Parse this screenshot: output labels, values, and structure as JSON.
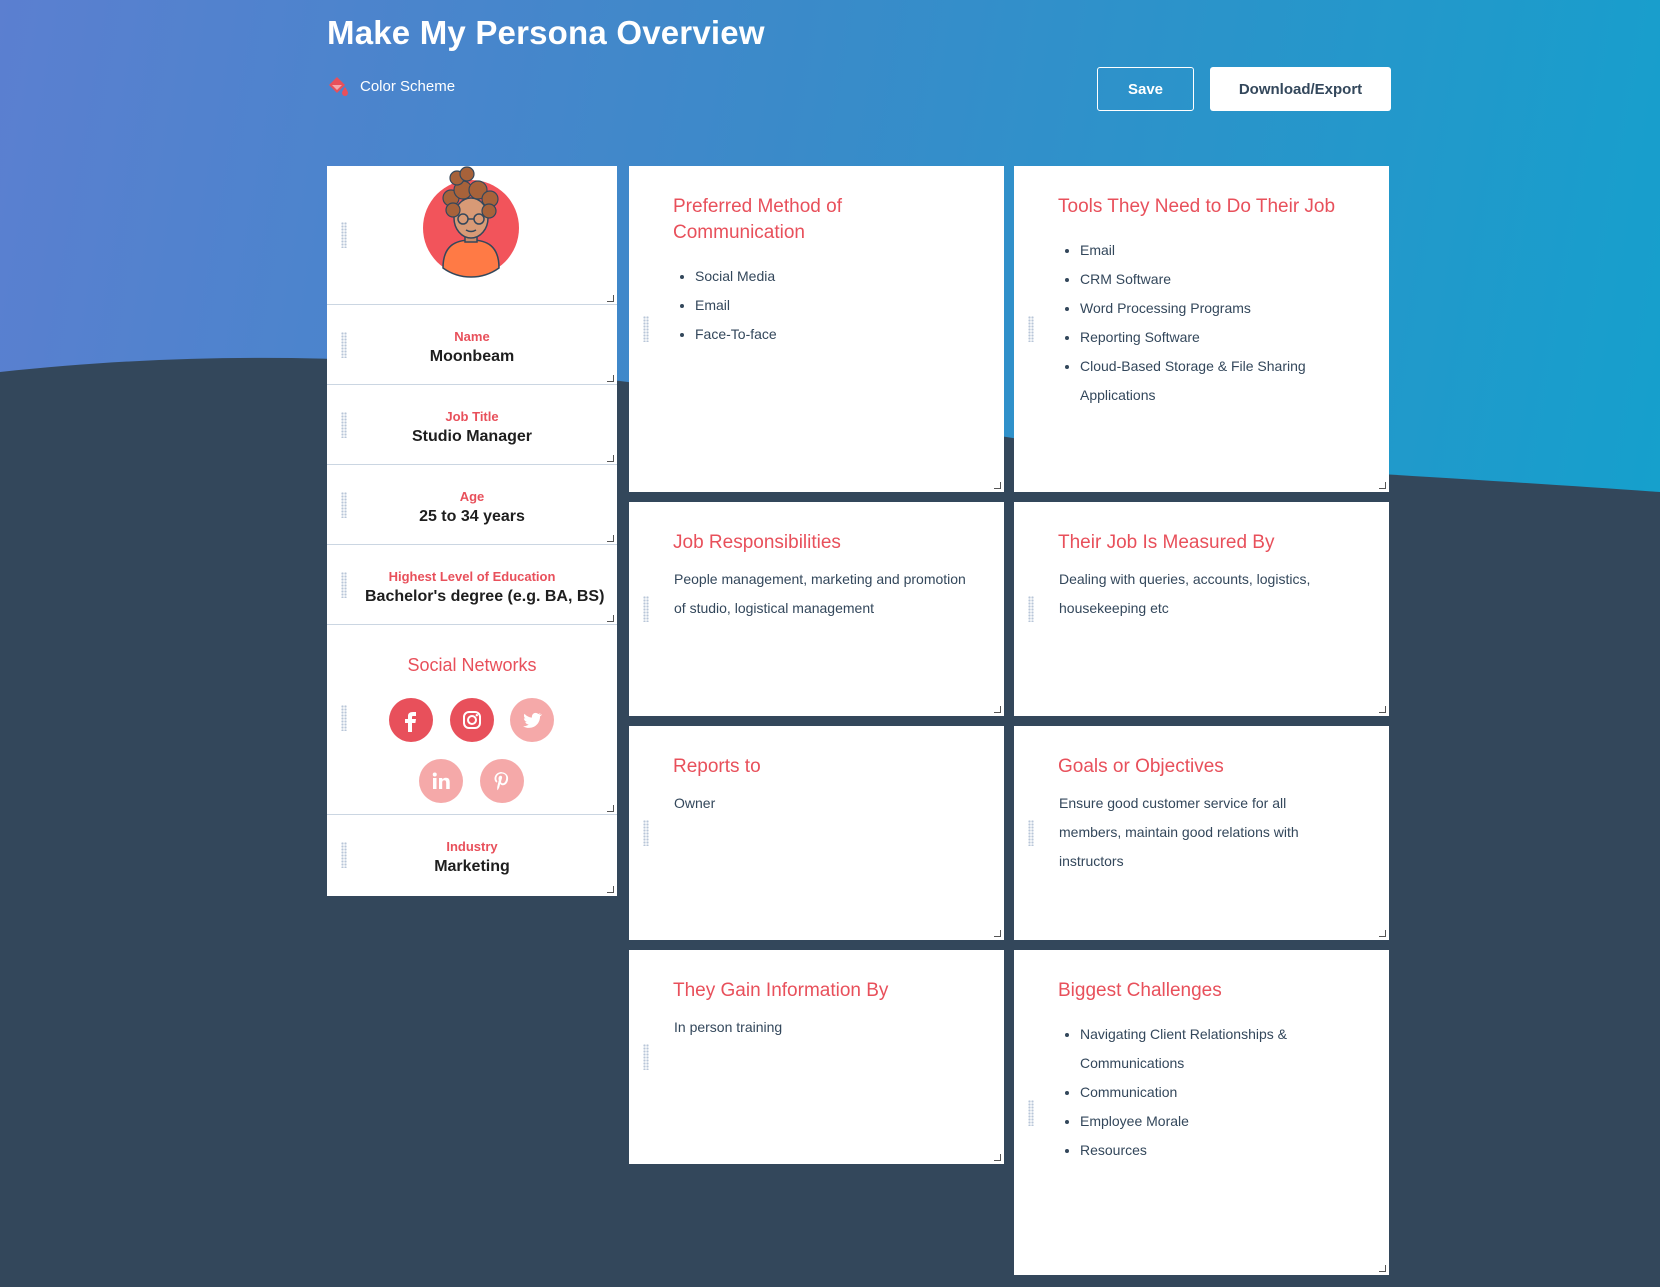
{
  "header": {
    "title": "Make My Persona Overview",
    "color_scheme_label": "Color Scheme",
    "save_label": "Save",
    "export_label": "Download/Export"
  },
  "colors": {
    "accent": "#e8505b",
    "dark_bg": "#33475b",
    "gradient_start": "#5b7fd0",
    "gradient_end": "#15a0cc"
  },
  "sidebar": {
    "avatar_icon": "avatar-icon",
    "name": {
      "label": "Name",
      "value": "Moonbeam"
    },
    "job_title": {
      "label": "Job Title",
      "value": "Studio Manager"
    },
    "age": {
      "label": "Age",
      "value": "25 to 34 years"
    },
    "education": {
      "label": "Highest Level of Education",
      "value": "Bachelor's degree (e.g. BA, BS)"
    },
    "social": {
      "title": "Social Networks",
      "networks": [
        "facebook-icon",
        "instagram-icon",
        "twitter-icon",
        "linkedin-icon",
        "pinterest-icon"
      ]
    },
    "industry": {
      "label": "Industry",
      "value": "Marketing"
    }
  },
  "cards": {
    "communication": {
      "title": "Preferred Method of Communication",
      "items": [
        "Social Media",
        "Email",
        "Face-To-face"
      ]
    },
    "tools": {
      "title": "Tools They Need to Do Their Job",
      "items": [
        "Email",
        "CRM Software",
        "Word Processing Programs",
        "Reporting Software",
        "Cloud-Based Storage & File Sharing Applications"
      ]
    },
    "responsibilities": {
      "title": "Job Responsibilities",
      "text": "People management, marketing and promotion of studio, logistical management"
    },
    "measured": {
      "title": "Their Job Is Measured By",
      "text": "Dealing with queries, accounts, logistics, housekeeping etc"
    },
    "reports": {
      "title": "Reports to",
      "text": "Owner"
    },
    "goals": {
      "title": "Goals or Objectives",
      "text": "Ensure good customer service for all members, maintain good relations with instructors"
    },
    "information": {
      "title": "They Gain Information By",
      "text": "In person training"
    },
    "challenges": {
      "title": "Biggest Challenges",
      "items": [
        "Navigating Client Relationships & Communications",
        "Communication",
        "Employee Morale",
        "Resources"
      ]
    }
  }
}
